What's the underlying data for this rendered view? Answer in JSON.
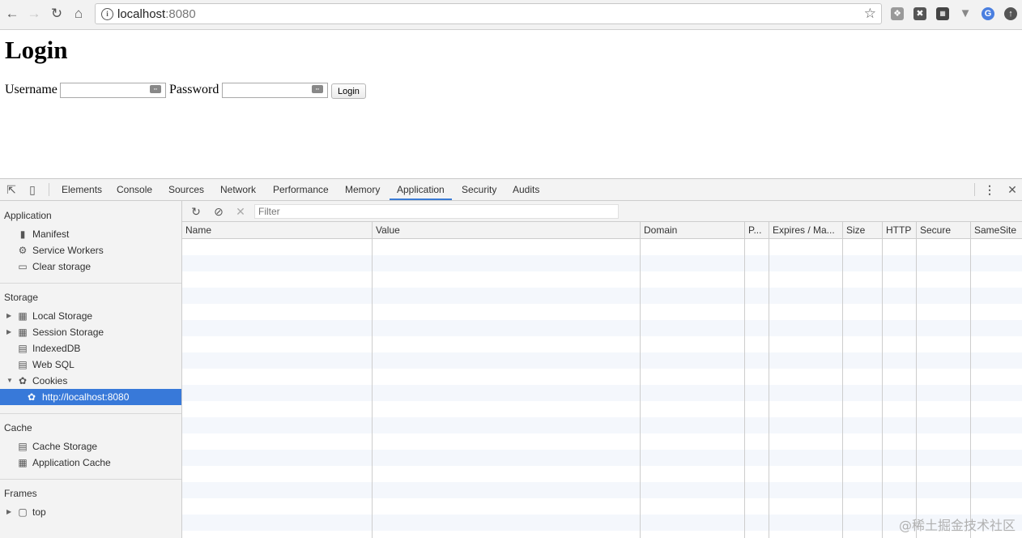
{
  "browser": {
    "url_host": "localhost",
    "url_port": ":8080",
    "icons": {
      "back": "arrow-left",
      "forward": "arrow-right",
      "reload": "reload",
      "home": "home",
      "info": "info",
      "bookmark": "star",
      "menu": "kebab"
    }
  },
  "page": {
    "title": "Login",
    "username_label": "Username",
    "password_label": "Password",
    "login_button": "Login"
  },
  "devtools": {
    "tabs": [
      "Elements",
      "Console",
      "Sources",
      "Network",
      "Performance",
      "Memory",
      "Application",
      "Security",
      "Audits"
    ],
    "active_tab": "Application",
    "sidebar": {
      "application_title": "Application",
      "application_items": [
        "Manifest",
        "Service Workers",
        "Clear storage"
      ],
      "storage_title": "Storage",
      "storage_items": [
        "Local Storage",
        "Session Storage",
        "IndexedDB",
        "Web SQL",
        "Cookies"
      ],
      "cookie_origin": "http://localhost:8080",
      "cache_title": "Cache",
      "cache_items": [
        "Cache Storage",
        "Application Cache"
      ],
      "frames_title": "Frames",
      "frames_items": [
        "top"
      ]
    },
    "toolbar": {
      "filter_placeholder": "Filter"
    },
    "columns": [
      "Name",
      "Value",
      "Domain",
      "P...",
      "Expires / Ma...",
      "Size",
      "HTTP",
      "Secure",
      "SameSite"
    ],
    "selection_color": "#3879d9",
    "rows": []
  },
  "watermark": "@稀土掘金技术社区"
}
